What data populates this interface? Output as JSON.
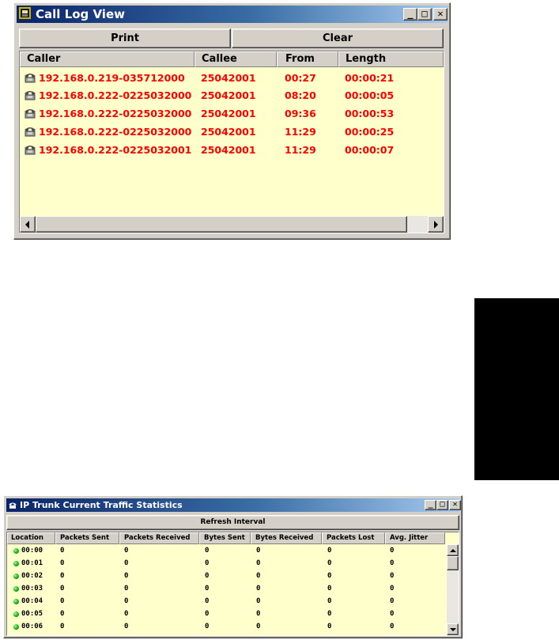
{
  "call_log_window": {
    "title": "Call Log View",
    "buttons": {
      "print": "Print",
      "clear": "Clear"
    },
    "columns": [
      "Caller",
      "Callee",
      "From",
      "Length"
    ],
    "rows": [
      {
        "caller": "192.168.0.219-035712000",
        "callee": "25042001",
        "from": "00:27",
        "length": "00:00:21"
      },
      {
        "caller": "192.168.0.222-0225032000",
        "callee": "25042001",
        "from": "08:20",
        "length": "00:00:05"
      },
      {
        "caller": "192.168.0.222-0225032000",
        "callee": "25042001",
        "from": "09:36",
        "length": "00:00:53"
      },
      {
        "caller": "192.168.0.222-0225032000",
        "callee": "25042001",
        "from": "11:29",
        "length": "00:00:25"
      },
      {
        "caller": "192.168.0.222-0225032001",
        "callee": "25042001",
        "from": "11:29",
        "length": "00:00:07"
      }
    ],
    "row_text_color": "#ff0000",
    "list_background": "#ffffcc",
    "row_icon": "phone-icon"
  },
  "traffic_window": {
    "title": "IP Trunk Current Traffic Statistics",
    "refresh_label": "Refresh Interval",
    "columns": [
      "Location",
      "Packets Sent",
      "Packets Received",
      "Bytes Sent",
      "Bytes Received",
      "Packets Lost",
      "Avg. Jitter"
    ],
    "rows": [
      {
        "location": "00:00",
        "packets_sent": "0",
        "packets_received": "0",
        "bytes_sent": "0",
        "bytes_received": "0",
        "packets_lost": "0",
        "avg_jitter": "0"
      },
      {
        "location": "00:01",
        "packets_sent": "0",
        "packets_received": "0",
        "bytes_sent": "0",
        "bytes_received": "0",
        "packets_lost": "0",
        "avg_jitter": "0"
      },
      {
        "location": "00:02",
        "packets_sent": "0",
        "packets_received": "0",
        "bytes_sent": "0",
        "bytes_received": "0",
        "packets_lost": "0",
        "avg_jitter": "0"
      },
      {
        "location": "00:03",
        "packets_sent": "0",
        "packets_received": "0",
        "bytes_sent": "0",
        "bytes_received": "0",
        "packets_lost": "0",
        "avg_jitter": "0"
      },
      {
        "location": "00:04",
        "packets_sent": "0",
        "packets_received": "0",
        "bytes_sent": "0",
        "bytes_received": "0",
        "packets_lost": "0",
        "avg_jitter": "0"
      },
      {
        "location": "00:05",
        "packets_sent": "0",
        "packets_received": "0",
        "bytes_sent": "0",
        "bytes_received": "0",
        "packets_lost": "0",
        "avg_jitter": "0"
      },
      {
        "location": "00:06",
        "packets_sent": "0",
        "packets_received": "0",
        "bytes_sent": "0",
        "bytes_received": "0",
        "packets_lost": "0",
        "avg_jitter": "0"
      }
    ],
    "status_icon": "green-status-icon",
    "status_color": "#22c022"
  },
  "window_controls": {
    "minimize": "_",
    "maximize": "□",
    "close": "✕"
  },
  "title_bar_color": "#0a246a",
  "side_tab_color": "#000000"
}
